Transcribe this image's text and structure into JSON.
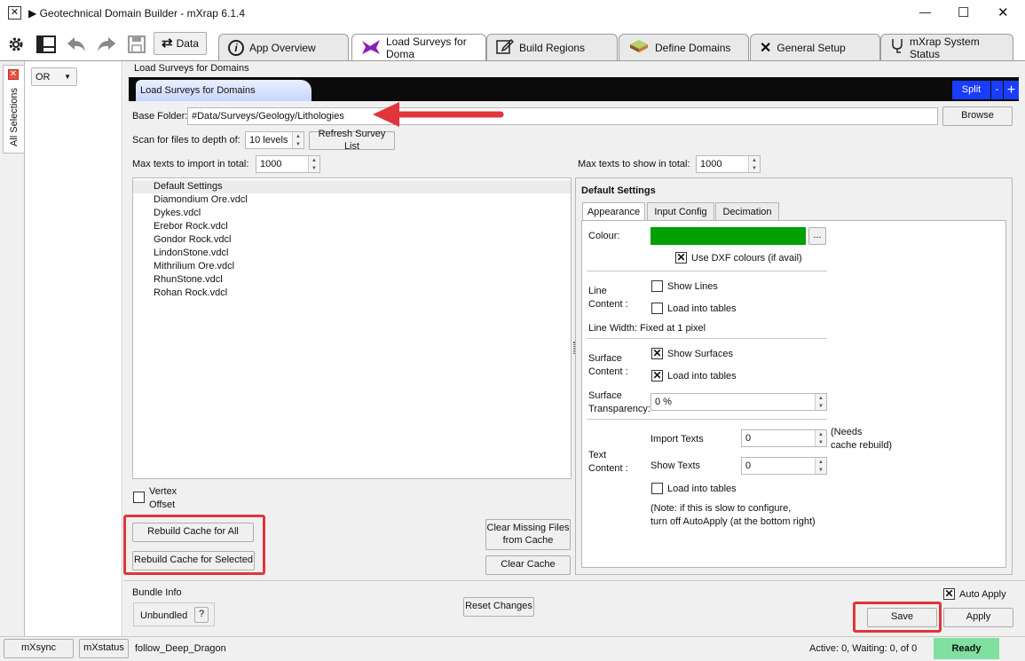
{
  "window": {
    "title": "▶ Geotechnical Domain Builder - mXrap 6.1.4",
    "minimize": "—",
    "maximize": "☐",
    "close": "✕"
  },
  "toolbar": {
    "data_label": "Data"
  },
  "tabs": [
    {
      "label": "App Overview"
    },
    {
      "label": "Load Surveys for Doma"
    },
    {
      "label": "Build Regions"
    },
    {
      "label": "Define Domains"
    },
    {
      "label": "General Setup"
    },
    {
      "label": "mXrap System Status"
    }
  ],
  "sidebar": {
    "label": "All Selections",
    "combo_value": "OR"
  },
  "breadcrumb": "Load Surveys for Domains",
  "panel": {
    "tab_label": "Load Surveys for Domains",
    "split_label": "Split",
    "minus_label": "-",
    "plus_label": "+"
  },
  "base_folder": {
    "label": "Base Folder:",
    "value": "#Data/Surveys/Geology/Lithologies",
    "browse_label": "Browse"
  },
  "scan": {
    "label": "Scan for files to depth of:",
    "value": "10 levels",
    "refresh_label": "Refresh Survey List"
  },
  "max_import": {
    "label": "Max texts to import in total:",
    "value": "1000"
  },
  "max_show": {
    "label": "Max texts to show in total:",
    "value": "1000"
  },
  "file_list": [
    "Default Settings",
    "Diamondium Ore.vdcl",
    "Dykes.vdcl",
    "Erebor Rock.vdcl",
    "Gondor Rock.vdcl",
    "LindonStone.vdcl",
    "Mithrilium Ore.vdcl",
    "RhunStone.vdcl",
    "Rohan Rock.vdcl"
  ],
  "vertex": {
    "label_line1": "Vertex",
    "label_line2": "Offset"
  },
  "buttons": {
    "rebuild_all": "Rebuild Cache for All",
    "rebuild_selected": "Rebuild Cache for Selected",
    "clear_missing_line1": "Clear Missing Files",
    "clear_missing_line2": "from Cache",
    "clear_cache": "Clear Cache",
    "reset_changes": "Reset Changes",
    "save": "Save",
    "apply": "Apply"
  },
  "settings": {
    "title": "Default Settings",
    "subtabs": [
      "Appearance",
      "Input Config",
      "Decimation"
    ],
    "colour_label": "Colour:",
    "colour_value": "#00a000",
    "colour_btn": "...",
    "use_dxf": "Use DXF colours (if avail)",
    "line_content_l1": "Line",
    "line_content_l2": "Content :",
    "show_lines": "Show Lines",
    "load_tables_lines": "Load into tables",
    "line_width": "Line Width: Fixed at 1 pixel",
    "surface_content_l1": "Surface",
    "surface_content_l2": "Content :",
    "show_surfaces": "Show Surfaces",
    "load_tables_surfaces": "Load into tables",
    "surface_transp_l1": "Surface",
    "surface_transp_l2": "Transparency:",
    "surface_transp_value": "0 %",
    "text_content_l1": "Text",
    "text_content_l2": "Content :",
    "import_texts_label": "Import Texts",
    "import_texts_value": "0",
    "needs_l1": "(Needs",
    "needs_l2": "cache rebuild)",
    "show_texts_label": "Show Texts",
    "show_texts_value": "0",
    "load_tables_texts": "Load into tables",
    "note_l1": "(Note: if this is slow to configure,",
    "note_l2": "turn off AutoApply (at the bottom right)"
  },
  "bundle": {
    "label": "Bundle Info",
    "value": "Unbundled",
    "help": "?"
  },
  "auto_apply": "Auto Apply",
  "status": {
    "mxsync": "mXsync",
    "mxstatus": "mXstatus",
    "user": "follow_Deep_Dragon",
    "active": "Active: 0, Waiting: 0, of 0",
    "ready": "Ready"
  },
  "colors": {
    "accent": "#1a3cff",
    "annotation": "#e0353a",
    "ready": "#7fe0a0"
  }
}
